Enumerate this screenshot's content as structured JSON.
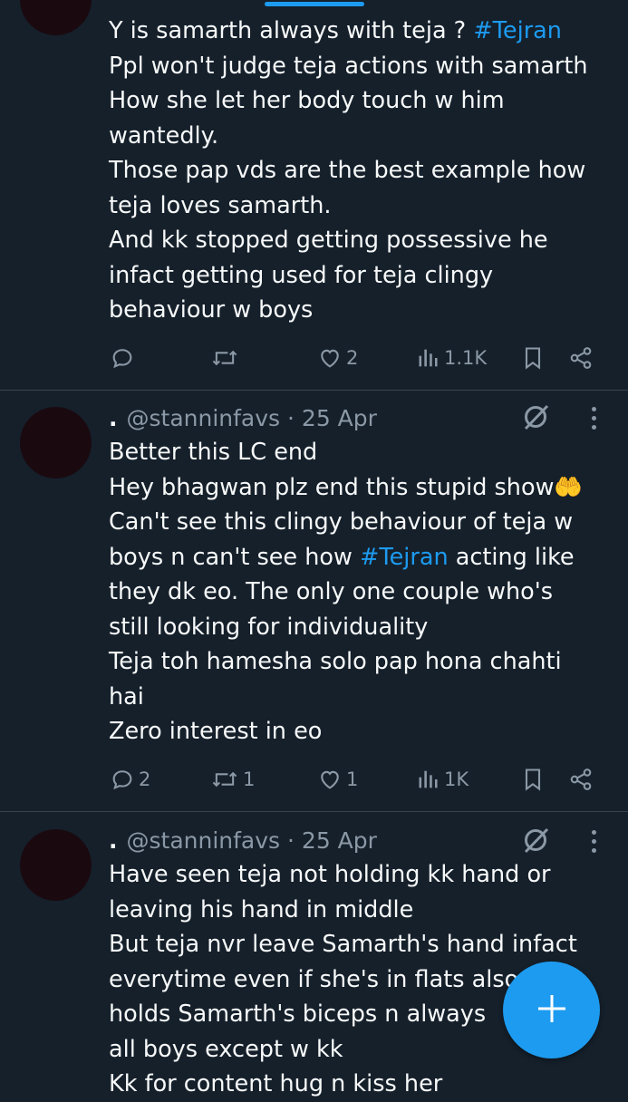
{
  "tweets": [
    {
      "handle": "",
      "date": "",
      "lines": [
        [
          {
            "t": "Y is samarth always with teja ? "
          },
          {
            "t": "#Tejran",
            "tag": true
          }
        ],
        [
          {
            "t": "Ppl won't judge teja actions with samarth"
          }
        ],
        [
          {
            "t": "How she let her body touch w him"
          }
        ],
        [
          {
            "t": "wantedly."
          }
        ],
        [
          {
            "t": "Those pap vds are the best example how"
          }
        ],
        [
          {
            "t": "teja loves samarth."
          }
        ],
        [
          {
            "t": "And kk stopped getting possessive he"
          }
        ],
        [
          {
            "t": "infact getting used for teja clingy"
          }
        ],
        [
          {
            "t": "behaviour w boys"
          }
        ]
      ],
      "replies": "",
      "retweets": "",
      "likes": "2",
      "views": "1.1K"
    },
    {
      "handle": "@stanninfavs",
      "date": "25 Apr",
      "lines": [
        [
          {
            "t": "Better this LC end"
          }
        ],
        [
          {
            "t": "Hey bhagwan plz end this stupid show🤲"
          }
        ],
        [
          {
            "t": "Can't see this clingy behaviour of teja w"
          }
        ],
        [
          {
            "t": "boys n can't see how "
          },
          {
            "t": "#Tejran",
            "tag": true
          },
          {
            "t": " acting like"
          }
        ],
        [
          {
            "t": "they dk eo. The only one couple who's"
          }
        ],
        [
          {
            "t": "still looking for individuality"
          }
        ],
        [
          {
            "t": "Teja toh hamesha solo pap hona chahti"
          }
        ],
        [
          {
            "t": "hai"
          }
        ],
        [
          {
            "t": "Zero interest in eo"
          }
        ]
      ],
      "replies": "2",
      "retweets": "1",
      "likes": "1",
      "views": "1K"
    },
    {
      "handle": "@stanninfavs",
      "date": "25 Apr",
      "lines": [
        [
          {
            "t": "Have seen teja not holding kk hand or"
          }
        ],
        [
          {
            "t": "leaving his hand in middle"
          }
        ],
        [
          {
            "t": "But teja nvr leave Samarth's hand infact"
          }
        ],
        [
          {
            "t": "everytime even if she's in flats also"
          }
        ],
        [
          {
            "t": "holds Samarth's biceps n always"
          }
        ],
        [
          {
            "t": "all boys except w kk"
          }
        ],
        [
          {
            "t": "Kk for content hug n kiss her"
          }
        ]
      ],
      "replies": "",
      "retweets": "",
      "likes": "",
      "views": ""
    }
  ],
  "header_separator": " · ",
  "fab": {
    "icon": "compose-plus-icon",
    "color": "#1d9bf0"
  },
  "colors": {
    "background": "#15202b",
    "text": "#f7f9f9",
    "muted": "#8b98a5",
    "accent": "#1d9bf0",
    "divider": "#38444d"
  }
}
